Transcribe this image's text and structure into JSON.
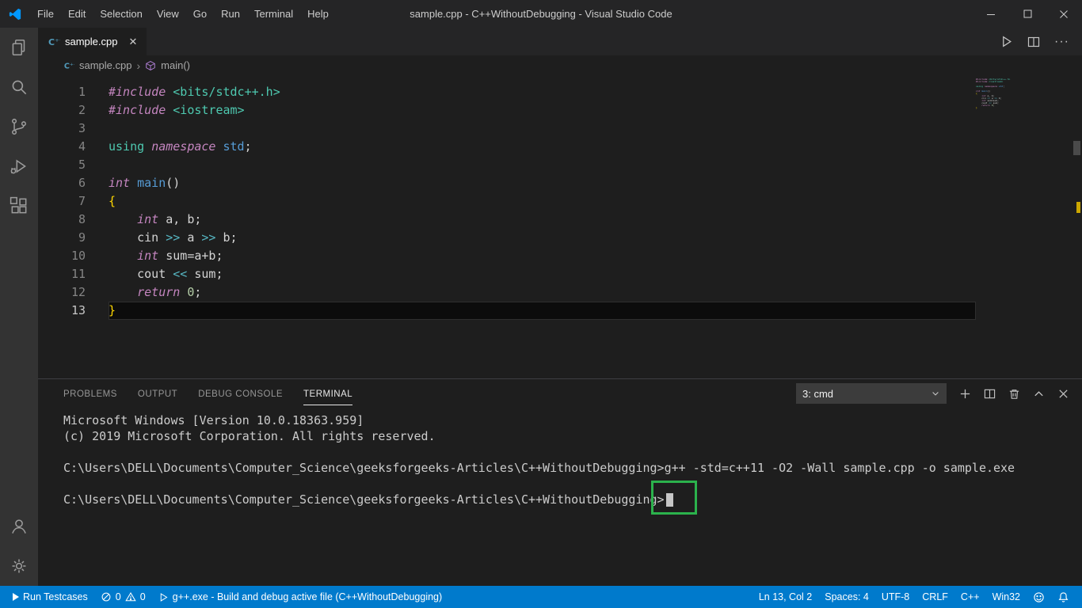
{
  "colors": {
    "status_bar": "#007acc",
    "activity_bar": "#333333",
    "editor_background": "#1e1e1e",
    "annotation_green": "#2bb24c",
    "logo_blue": "#0098ff"
  },
  "title_bar": {
    "title": "sample.cpp - C++WithoutDebugging - Visual Studio Code",
    "menus": [
      "File",
      "Edit",
      "Selection",
      "View",
      "Go",
      "Run",
      "Terminal",
      "Help"
    ]
  },
  "activity_bar": {
    "icons": [
      "explorer-icon",
      "search-icon",
      "source-control-icon",
      "run-debug-icon",
      "extensions-icon"
    ],
    "bottom_icons": [
      "account-icon",
      "settings-gear-icon"
    ]
  },
  "editor": {
    "tab_label": "sample.cpp",
    "tab_close_glyph": "✕",
    "breadcrumb": {
      "file": "sample.cpp",
      "separator": "›",
      "symbol": "main()"
    },
    "actions": {
      "more_glyph": "···"
    },
    "cursor_line": 13,
    "lines": [
      {
        "num": 1,
        "segments": [
          {
            "t": "#include",
            "c": "pp"
          },
          {
            "t": " "
          },
          {
            "t": "<bits/stdc++.h>",
            "c": "inc"
          }
        ]
      },
      {
        "num": 2,
        "segments": [
          {
            "t": "#include",
            "c": "pp"
          },
          {
            "t": " "
          },
          {
            "t": "<iostream>",
            "c": "inc"
          }
        ]
      },
      {
        "num": 3,
        "segments": []
      },
      {
        "num": 4,
        "segments": [
          {
            "t": "using",
            "c": "teal"
          },
          {
            "t": " "
          },
          {
            "t": "namespace",
            "c": "pp"
          },
          {
            "t": " "
          },
          {
            "t": "std",
            "c": "blue"
          },
          {
            "t": ";"
          }
        ]
      },
      {
        "num": 5,
        "segments": []
      },
      {
        "num": 6,
        "segments": [
          {
            "t": "int",
            "c": "pp"
          },
          {
            "t": " "
          },
          {
            "t": "main",
            "c": "blue"
          },
          {
            "t": "()"
          }
        ]
      },
      {
        "num": 7,
        "segments": [
          {
            "t": "{",
            "c": "gold"
          }
        ]
      },
      {
        "num": 8,
        "segments": [
          {
            "t": "    "
          },
          {
            "t": "int",
            "c": "pp"
          },
          {
            "t": " a, b;"
          }
        ]
      },
      {
        "num": 9,
        "segments": [
          {
            "t": "    cin "
          },
          {
            "t": ">>",
            "c": "cyan"
          },
          {
            "t": " a "
          },
          {
            "t": ">>",
            "c": "cyan"
          },
          {
            "t": " b;"
          }
        ]
      },
      {
        "num": 10,
        "segments": [
          {
            "t": "    "
          },
          {
            "t": "int",
            "c": "pp"
          },
          {
            "t": " sum=a+b;"
          }
        ]
      },
      {
        "num": 11,
        "segments": [
          {
            "t": "    cout "
          },
          {
            "t": "<<",
            "c": "cyan"
          },
          {
            "t": " sum;"
          }
        ]
      },
      {
        "num": 12,
        "segments": [
          {
            "t": "    "
          },
          {
            "t": "return",
            "c": "pp"
          },
          {
            "t": " "
          },
          {
            "t": "0",
            "c": "num"
          },
          {
            "t": ";"
          }
        ]
      },
      {
        "num": 13,
        "segments": [
          {
            "t": "}",
            "c": "gold"
          }
        ]
      }
    ]
  },
  "panel": {
    "tabs": [
      "PROBLEMS",
      "OUTPUT",
      "DEBUG CONSOLE",
      "TERMINAL"
    ],
    "active_tab": "TERMINAL",
    "terminal_select": "3: cmd",
    "action_icons": [
      "new-terminal-icon",
      "split-terminal-icon",
      "kill-terminal-icon",
      "maximize-panel-icon",
      "close-panel-icon"
    ],
    "terminal_lines": [
      "Microsoft Windows [Version 10.0.18363.959]",
      "(c) 2019 Microsoft Corporation. All rights reserved.",
      "",
      "C:\\Users\\DELL\\Documents\\Computer_Science\\geeksforgeeks-Articles\\C++WithoutDebugging>g++ -std=c++11 -O2 -Wall sample.cpp -o sample.exe",
      "",
      "C:\\Users\\DELL\\Documents\\Computer_Science\\geeksforgeeks-Articles\\C++WithoutDebugging>"
    ]
  },
  "status_bar": {
    "run_testcases": "Run Testcases",
    "errors": "0",
    "warnings": "0",
    "debug_label": "g++.exe - Build and debug active file (C++WithoutDebugging)",
    "right": [
      "Ln 13, Col 2",
      "Spaces: 4",
      "UTF-8",
      "CRLF",
      "C++",
      "Win32"
    ],
    "right_icons": [
      "feedback-smiley-icon",
      "notifications-bell-icon"
    ]
  }
}
